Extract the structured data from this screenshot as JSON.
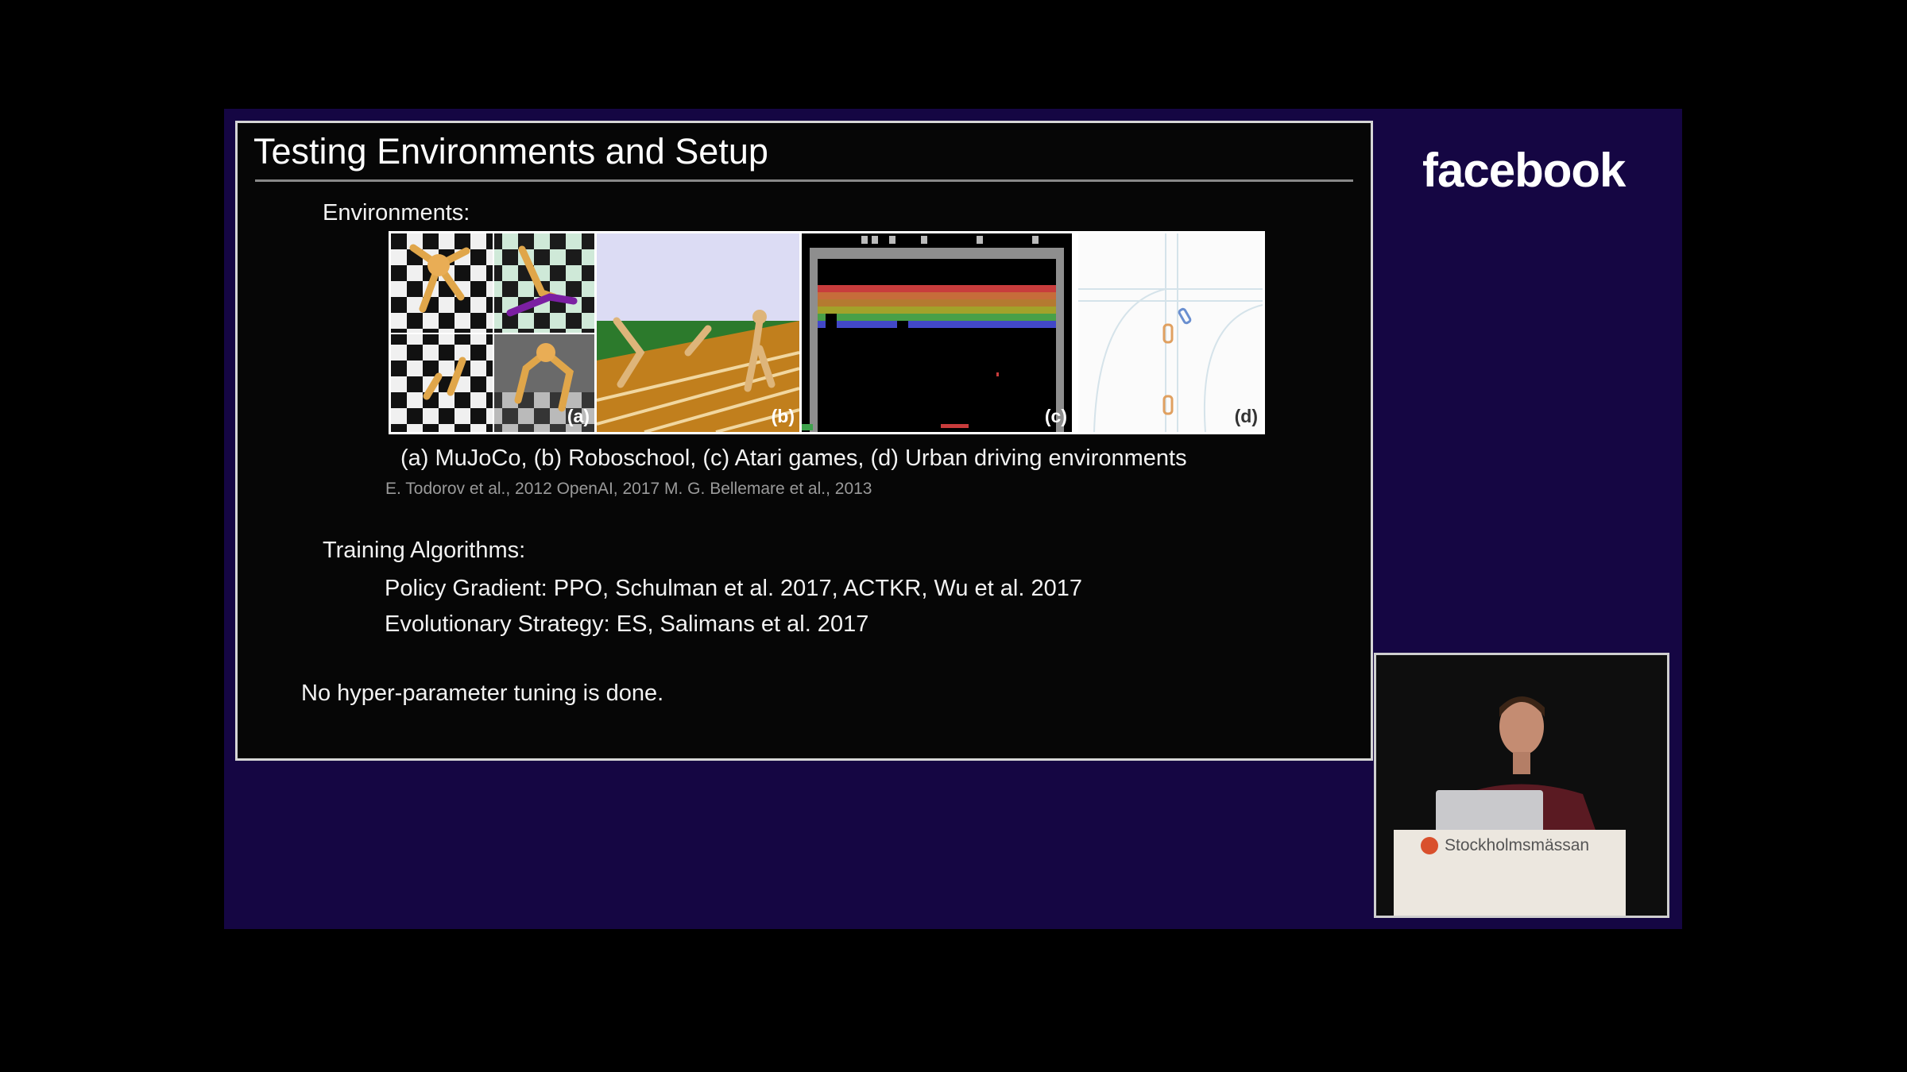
{
  "slide": {
    "title": "Testing Environments and Setup",
    "environments_heading": "Environments:",
    "panels": [
      {
        "id": "a",
        "label": "(a)"
      },
      {
        "id": "b",
        "label": "(b)"
      },
      {
        "id": "c",
        "label": "(c)"
      },
      {
        "id": "d",
        "label": "(d)"
      }
    ],
    "caption": "(a) MuJoCo, (b) Roboschool, (c) Atari games, (d) Urban driving environments",
    "citations": "E. Todorov et al., 2012   OpenAI, 2017   M. G. Bellemare et al., 2013",
    "training_heading": "Training Algorithms:",
    "algorithms": [
      "Policy Gradient: PPO, Schulman et al. 2017, ACTKR, Wu et al. 2017",
      "Evolutionary Strategy: ES, Salimans et al. 2017"
    ],
    "note": "No hyper-parameter tuning is done."
  },
  "brand": {
    "logo_text": "facebook"
  },
  "camera": {
    "podium_label": "Stockholmsmässan"
  },
  "colors": {
    "stage_background": "#150643",
    "slide_background": "#060606",
    "accent_venue": "#d9502d"
  }
}
